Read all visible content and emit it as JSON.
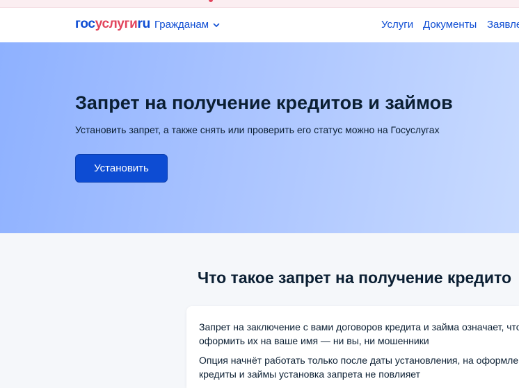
{
  "header": {
    "logo": {
      "part1": "гос",
      "part2": "услуги",
      "part3": "ru"
    },
    "citizens_menu": "Гражданам",
    "nav": [
      "Услуги",
      "Документы",
      "Заявле"
    ]
  },
  "hero": {
    "title": "Запрет на получение кредитов и займов",
    "subtitle": "Установить запрет, а также снять или проверить его статус можно на Госуслугах",
    "button": "Установить"
  },
  "section": {
    "title": "Что такое запрет на получение кредито",
    "card_lines": [
      "Запрет на заключение с вами договоров кредита и займа означает, что н",
      "оформить их на ваше имя — ни вы, ни мошенники",
      "Опция начнёт работать только после даты установления, на оформленн",
      "кредиты и займы установка запрета не повлияет"
    ]
  },
  "colors": {
    "brand_blue": "#0d4cd3",
    "brand_red": "#e2445c",
    "text": "#0b1f33"
  }
}
